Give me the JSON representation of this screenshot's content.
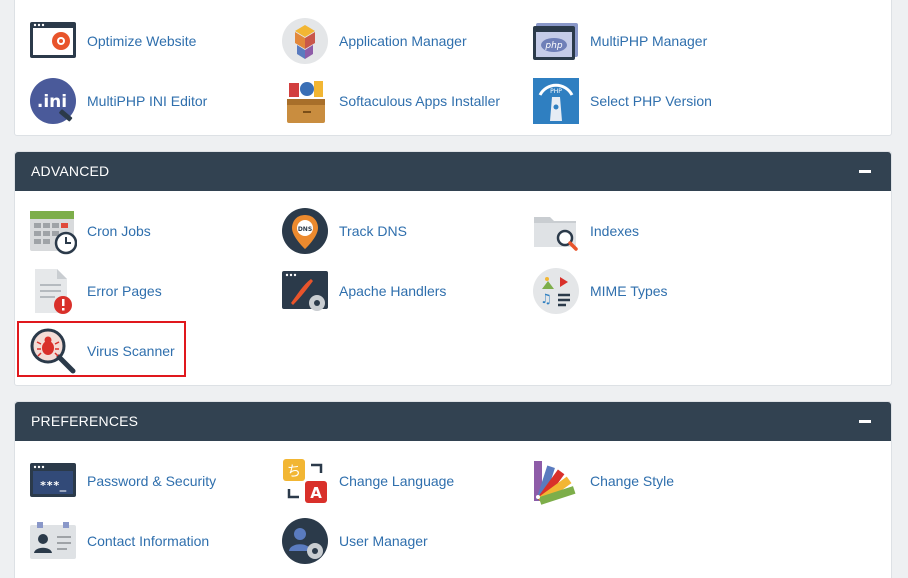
{
  "software": {
    "items": [
      {
        "label": "Optimize Website",
        "icon": "optimize-website-icon"
      },
      {
        "label": "Application Manager",
        "icon": "application-manager-icon"
      },
      {
        "label": "MultiPHP Manager",
        "icon": "multiphp-manager-icon"
      },
      {
        "label": "MultiPHP INI Editor",
        "icon": "multiphp-ini-editor-icon"
      },
      {
        "label": "Softaculous Apps Installer",
        "icon": "softaculous-icon"
      },
      {
        "label": "Select PHP Version",
        "icon": "select-php-version-icon"
      }
    ]
  },
  "advanced": {
    "title": "ADVANCED",
    "items": [
      {
        "label": "Cron Jobs",
        "icon": "cron-jobs-icon"
      },
      {
        "label": "Track DNS",
        "icon": "track-dns-icon"
      },
      {
        "label": "Indexes",
        "icon": "indexes-icon"
      },
      {
        "label": "Error Pages",
        "icon": "error-pages-icon"
      },
      {
        "label": "Apache Handlers",
        "icon": "apache-handlers-icon"
      },
      {
        "label": "MIME Types",
        "icon": "mime-types-icon"
      },
      {
        "label": "Virus Scanner",
        "icon": "virus-scanner-icon",
        "highlighted": true
      }
    ]
  },
  "preferences": {
    "title": "PREFERENCES",
    "items": [
      {
        "label": "Password & Security",
        "icon": "password-security-icon"
      },
      {
        "label": "Change Language",
        "icon": "change-language-icon"
      },
      {
        "label": "Change Style",
        "icon": "change-style-icon"
      },
      {
        "label": "Contact Information",
        "icon": "contact-information-icon"
      },
      {
        "label": "User Manager",
        "icon": "user-manager-icon"
      }
    ]
  },
  "icon_texts": {
    "php": "php",
    "ini": ".ini",
    "php2": "PHP",
    "dns": "DNS",
    "password": "***_",
    "lang_a": "A",
    "lang_chi": "ち"
  },
  "colors": {
    "header_bg": "#324251",
    "link": "#2f6fad",
    "highlight_border": "#e0181d"
  }
}
